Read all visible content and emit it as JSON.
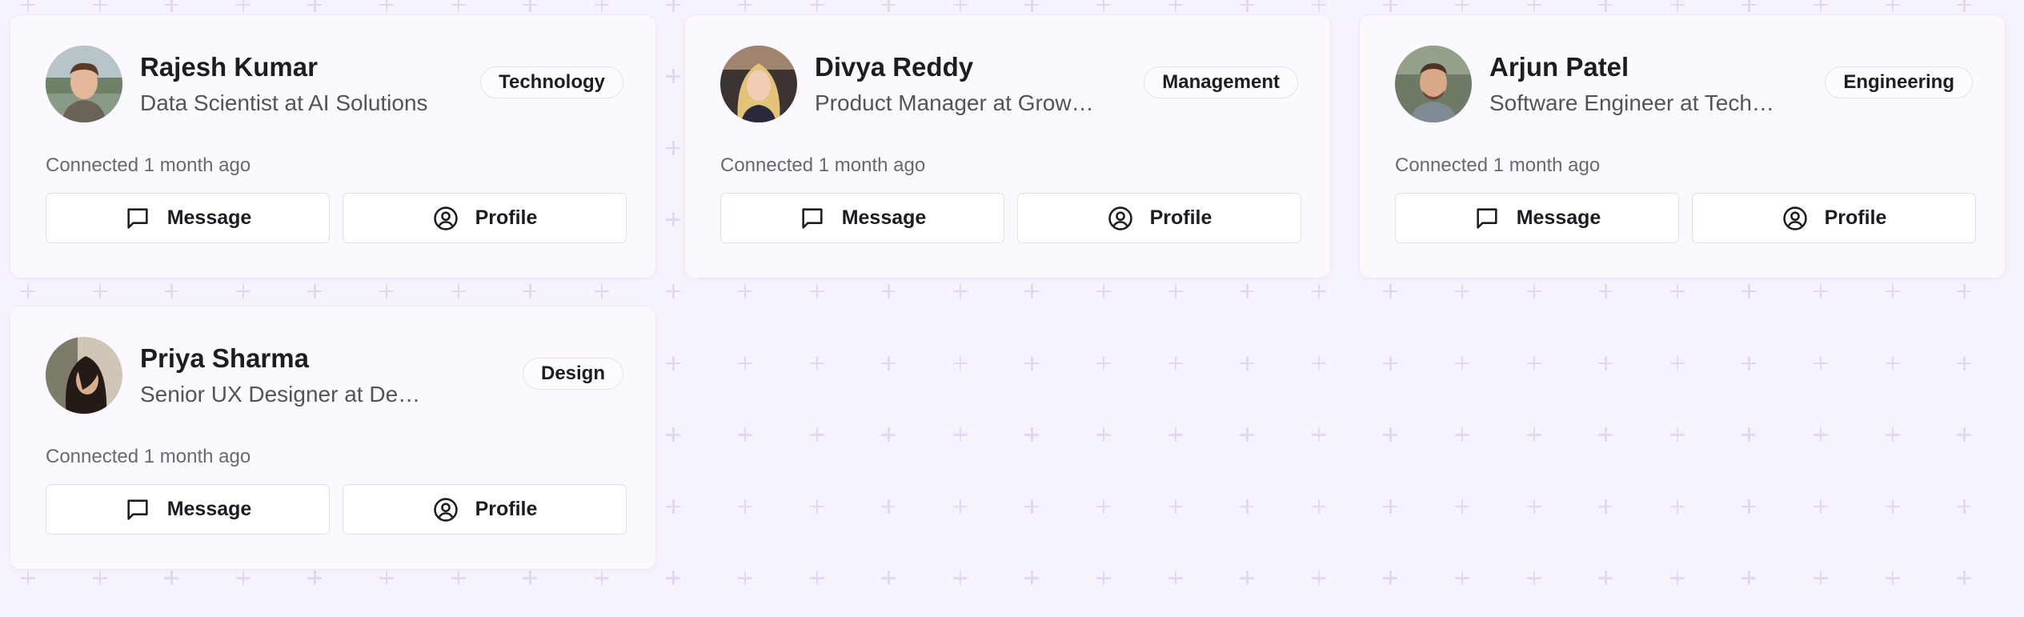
{
  "connections": [
    {
      "name": "Rajesh Kumar",
      "title": "Data Scientist at AI Solutions",
      "tag": "Technology",
      "connected": "Connected 1 month ago",
      "message_label": "Message",
      "profile_label": "Profile"
    },
    {
      "name": "Divya Reddy",
      "title": "Product Manager at Growth Inc",
      "tag": "Management",
      "connected": "Connected 1 month ago",
      "message_label": "Message",
      "profile_label": "Profile"
    },
    {
      "name": "Arjun Patel",
      "title": "Software Engineer at TechLabs",
      "tag": "Engineering",
      "connected": "Connected 1 month ago",
      "message_label": "Message",
      "profile_label": "Profile"
    },
    {
      "name": "Priya Sharma",
      "title": "Senior UX Designer at Design Co",
      "tag": "Design",
      "connected": "Connected 1 month ago",
      "message_label": "Message",
      "profile_label": "Profile"
    }
  ],
  "icons": {
    "message": "message-square-icon",
    "profile": "user-circle-icon"
  },
  "colors": {
    "background": "#f7f3fd",
    "card": "#fbf8fe",
    "pattern": "#e3d8f3",
    "text_primary": "#1e1b22",
    "text_secondary": "#55525c"
  }
}
